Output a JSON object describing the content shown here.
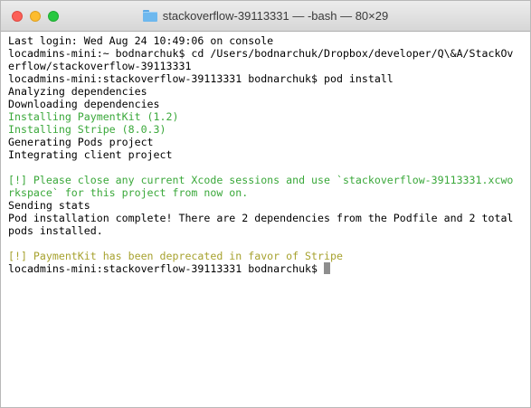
{
  "window": {
    "title": "stackoverflow-39113331 — -bash — 80×29"
  },
  "terminal": {
    "lines": [
      {
        "text": "Last login: Wed Aug 24 10:49:06 on console",
        "style": "normal"
      },
      {
        "text": "locadmins-mini:~ bodnarchuk$ cd /Users/bodnarchuk/Dropbox/developer/Q\\&A/StackOv",
        "style": "normal"
      },
      {
        "text": "erflow/stackoverflow-39113331",
        "style": "normal"
      },
      {
        "text": "locadmins-mini:stackoverflow-39113331 bodnarchuk$ pod install",
        "style": "normal"
      },
      {
        "text": "Analyzing dependencies",
        "style": "normal"
      },
      {
        "text": "Downloading dependencies",
        "style": "normal"
      },
      {
        "text": "Installing PaymentKit (1.2)",
        "style": "green"
      },
      {
        "text": "Installing Stripe (8.0.3)",
        "style": "green"
      },
      {
        "text": "Generating Pods project",
        "style": "normal"
      },
      {
        "text": "Integrating client project",
        "style": "normal"
      },
      {
        "text": "",
        "style": "normal"
      },
      {
        "text": "[!] Please close any current Xcode sessions and use `stackoverflow-39113331.xcwo",
        "style": "green"
      },
      {
        "text": "rkspace` for this project from now on.",
        "style": "green"
      },
      {
        "text": "Sending stats",
        "style": "normal"
      },
      {
        "text": "Pod installation complete! There are 2 dependencies from the Podfile and 2 total",
        "style": "normal"
      },
      {
        "text": "pods installed.",
        "style": "normal"
      },
      {
        "text": "",
        "style": "normal"
      },
      {
        "text": "[!] PaymentKit has been deprecated in favor of Stripe",
        "style": "yellow"
      },
      {
        "text": "locadmins-mini:stackoverflow-39113331 bodnarchuk$ ",
        "style": "normal"
      }
    ]
  },
  "colors": {
    "green_output": "#3aa83a",
    "yellow_output": "#a7a22f",
    "cursor": "#8e8e8e"
  }
}
